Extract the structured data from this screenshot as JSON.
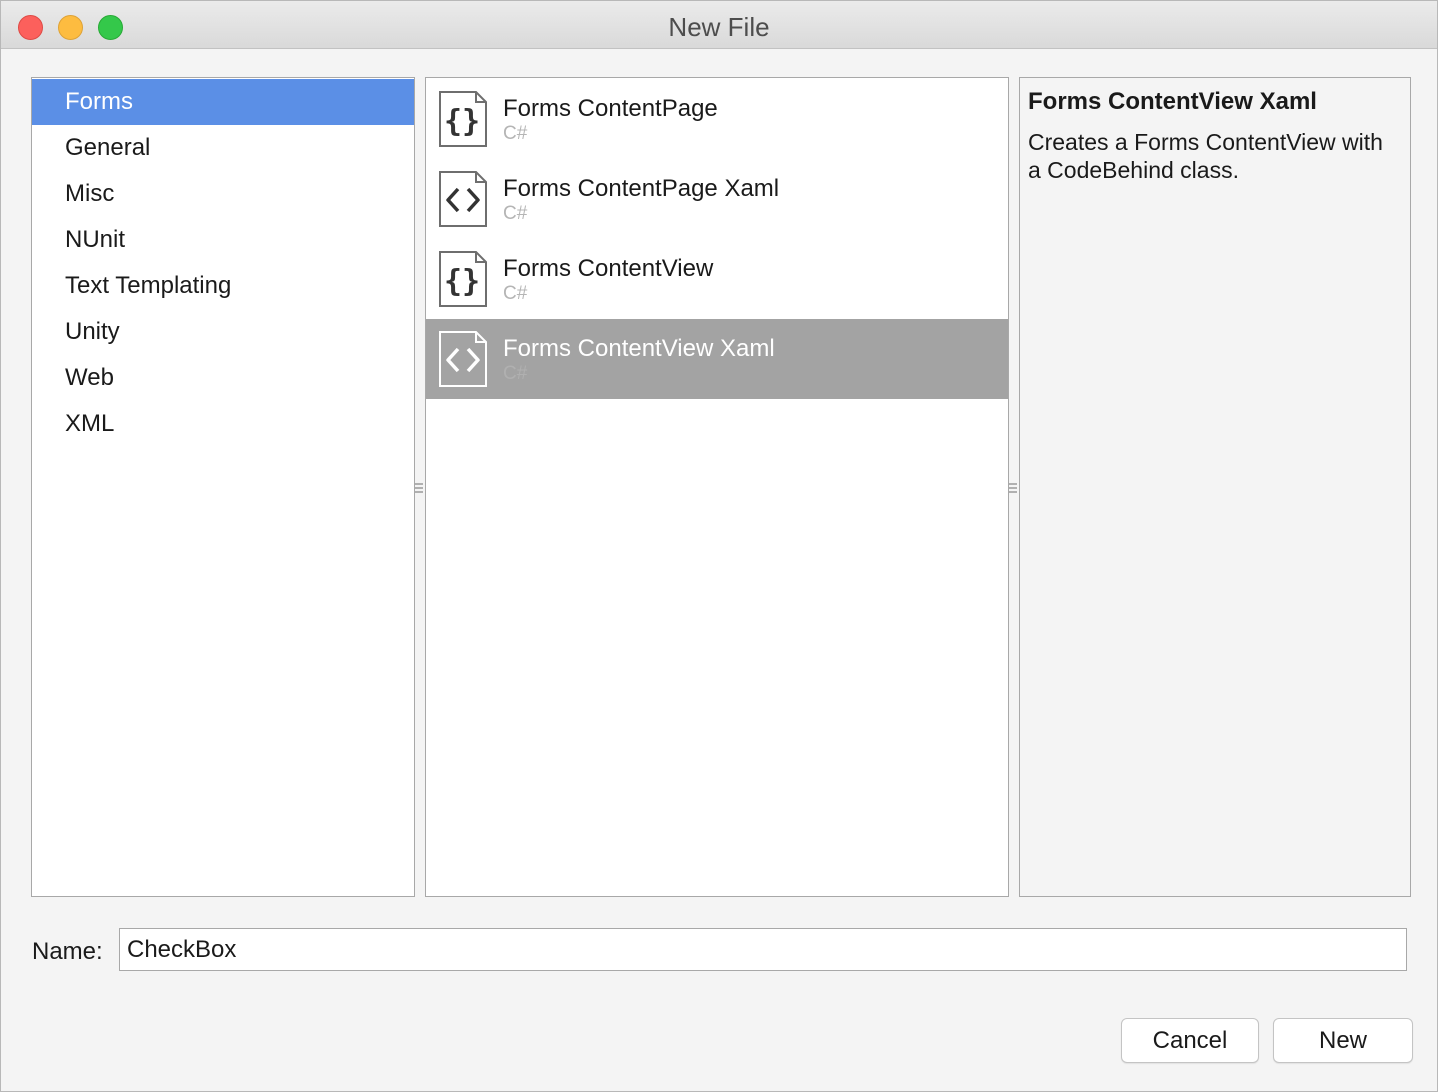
{
  "window": {
    "title": "New File"
  },
  "categories": [
    {
      "label": "Forms",
      "selected": true
    },
    {
      "label": "General"
    },
    {
      "label": "Misc"
    },
    {
      "label": "NUnit"
    },
    {
      "label": "Text Templating"
    },
    {
      "label": "Unity"
    },
    {
      "label": "Web"
    },
    {
      "label": "XML"
    }
  ],
  "templates": [
    {
      "name": "Forms ContentPage",
      "lang": "C#",
      "icon": "braces-file-icon"
    },
    {
      "name": "Forms ContentPage Xaml",
      "lang": "C#",
      "icon": "angle-brackets-file-icon"
    },
    {
      "name": "Forms ContentView",
      "lang": "C#",
      "icon": "braces-file-icon"
    },
    {
      "name": "Forms ContentView Xaml",
      "lang": "C#",
      "icon": "angle-brackets-file-icon",
      "selected": true
    }
  ],
  "description": {
    "title": "Forms ContentView Xaml",
    "text": "Creates a Forms ContentView with a CodeBehind class."
  },
  "name_field": {
    "label": "Name:",
    "value": "CheckBox"
  },
  "buttons": {
    "cancel": "Cancel",
    "new": "New"
  },
  "colors": {
    "selection_blue": "#5b8fe6",
    "selection_gray": "#a3a3a3"
  }
}
